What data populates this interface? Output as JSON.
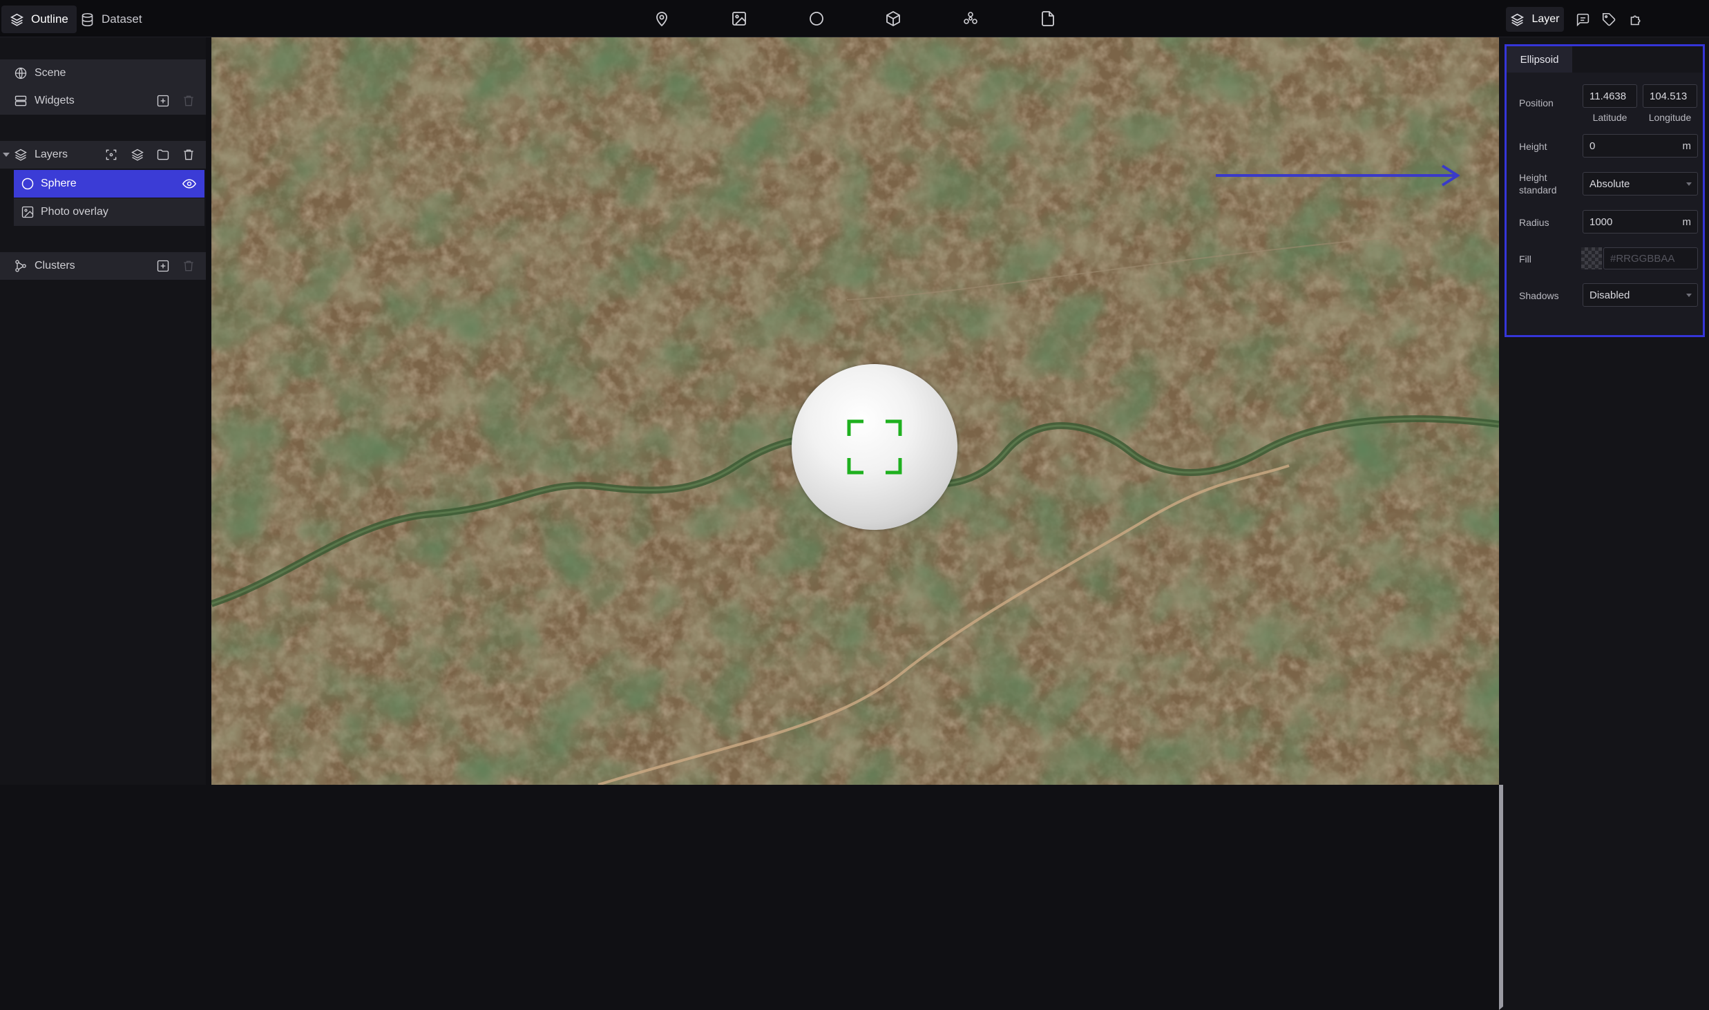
{
  "topbar": {
    "tabs": [
      {
        "label": "Outline",
        "icon": "layers-icon"
      },
      {
        "label": "Dataset",
        "icon": "database-icon"
      }
    ],
    "tools": [
      "map-pin-icon",
      "image-icon",
      "circle-icon",
      "box-icon",
      "cluster-icon",
      "file-icon"
    ],
    "right_tabs": [
      {
        "label": "Layer",
        "icon": "layers-icon"
      },
      {
        "label": "",
        "icon": "comment-icon"
      },
      {
        "label": "",
        "icon": "tag-icon"
      },
      {
        "label": "",
        "icon": "puzzle-icon"
      }
    ]
  },
  "outline": {
    "scene": "Scene",
    "widgets": "Widgets",
    "layers": "Layers",
    "layer_items": [
      {
        "label": "Sphere",
        "icon": "circle-icon",
        "selected": true
      },
      {
        "label": "Photo overlay",
        "icon": "image-icon",
        "selected": false
      }
    ],
    "clusters": "Clusters"
  },
  "properties": {
    "tab": "Ellipsoid",
    "position_label": "Position",
    "latitude": "11.4638",
    "longitude": "104.513",
    "latitude_label": "Latitude",
    "longitude_label": "Longitude",
    "height_label": "Height",
    "height_value": "0",
    "height_unit": "m",
    "height_standard_label_1": "Height",
    "height_standard_label_2": "standard",
    "height_standard_value": "Absolute",
    "radius_label": "Radius",
    "radius_value": "1000",
    "radius_unit": "m",
    "fill_label": "Fill",
    "fill_placeholder": "#RRGGBBAA",
    "shadows_label": "Shadows",
    "shadows_value": "Disabled"
  },
  "colors": {
    "accent": "#3b3cd6",
    "highlight_border": "#3535d8",
    "focus_green": "#22b322"
  }
}
